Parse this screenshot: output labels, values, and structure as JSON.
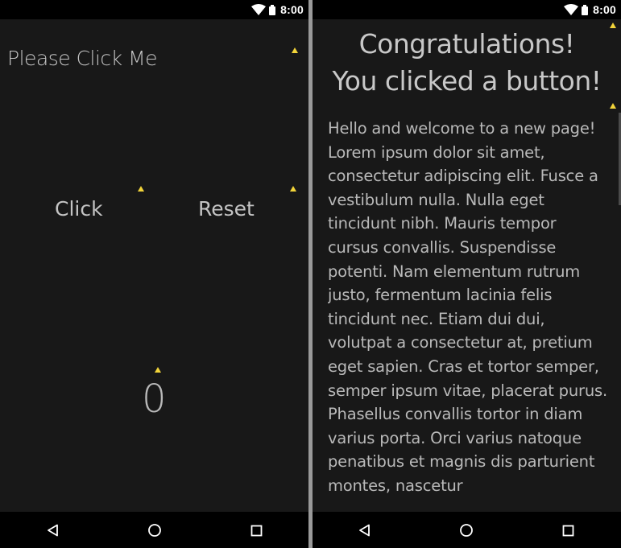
{
  "status_bar": {
    "time": "8:00",
    "icons": [
      "wifi-icon",
      "battery-icon"
    ]
  },
  "left_screen": {
    "title": "Please Click Me",
    "buttons": {
      "click_label": "Click",
      "reset_label": "Reset"
    },
    "counter_value": "0"
  },
  "right_screen": {
    "heading_line1": "Congratulations!",
    "heading_line2": "You clicked a button!",
    "body": "Hello and welcome to a new page! Lorem ipsum dolor sit amet, consectetur adipiscing elit. Fusce a vestibulum nulla. Nulla eget tincidunt nibh. Mauris tempor cursus convallis. Suspendisse potenti. Nam elementum rutrum justo, fermentum lacinia felis tincidunt nec. Etiam dui dui, volutpat a consectetur at, pretium eget sapien. Cras et tortor semper, semper ipsum vitae, placerat purus. Phasellus convallis tortor in diam varius porta. Orci varius natoque penatibus et magnis dis parturient montes, nascetur"
  },
  "nav_bar": {
    "buttons": [
      "back-icon",
      "home-icon",
      "recents-icon"
    ]
  },
  "colors": {
    "screen_background": "#181818",
    "bars": "#000000",
    "text": "#c4c4c4",
    "warning_marker": "#f2d43a",
    "divider": "#9a9a9a"
  }
}
